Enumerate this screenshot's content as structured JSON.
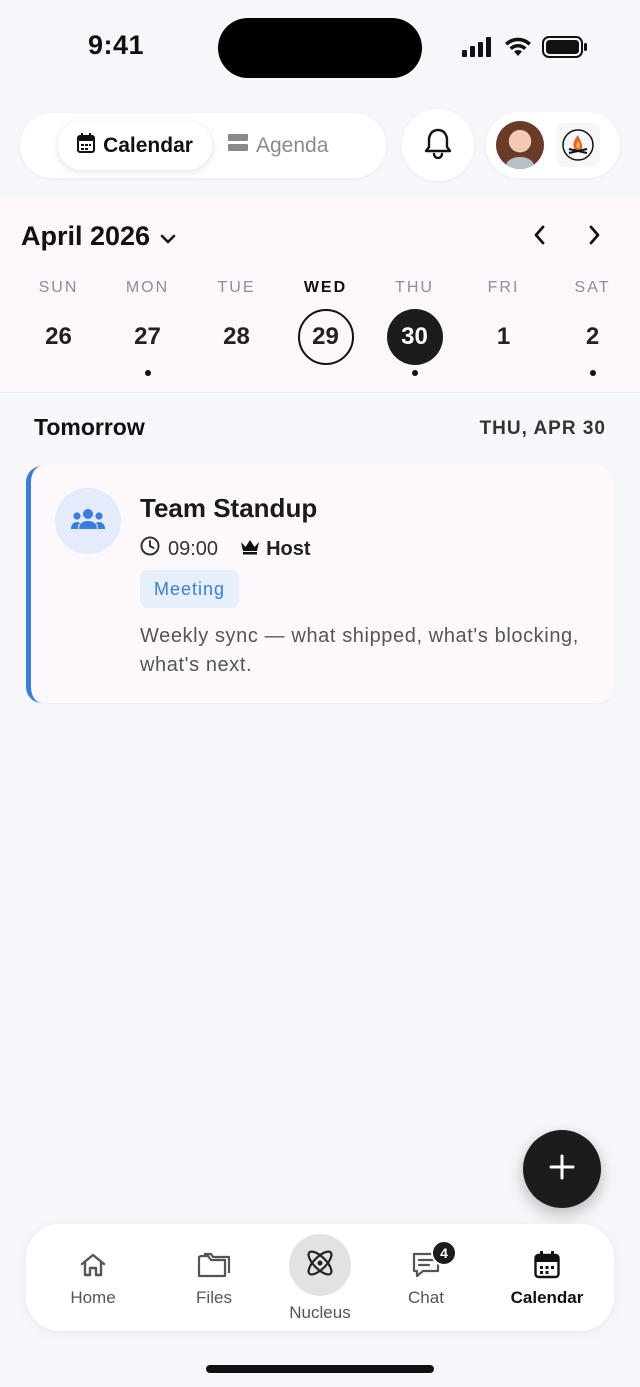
{
  "status_bar": {
    "time": "9:41"
  },
  "view_toggle": {
    "calendar_label": "Calendar",
    "agenda_label": "Agenda"
  },
  "calendar": {
    "month_label": "April 2026",
    "days": [
      {
        "name": "SUN",
        "num": "26",
        "dot": false,
        "state": "normal"
      },
      {
        "name": "MON",
        "num": "27",
        "dot": true,
        "state": "normal"
      },
      {
        "name": "TUE",
        "num": "28",
        "dot": false,
        "state": "normal"
      },
      {
        "name": "WED",
        "num": "29",
        "dot": false,
        "state": "today"
      },
      {
        "name": "THU",
        "num": "30",
        "dot": true,
        "state": "selected"
      },
      {
        "name": "FRI",
        "num": "1",
        "dot": false,
        "state": "normal"
      },
      {
        "name": "SAT",
        "num": "2",
        "dot": true,
        "state": "normal"
      }
    ]
  },
  "section": {
    "title": "Tomorrow",
    "date": "THU, APR 30"
  },
  "event": {
    "icon": "group-icon",
    "title": "Team Standup",
    "time": "09:00",
    "role": "Host",
    "tag": "Meeting",
    "description": "Weekly sync — what shipped, what's blocking, what's next.",
    "accent_color": "#3b7ddd"
  },
  "bottom_nav": {
    "home": "Home",
    "files": "Files",
    "nucleus": "Nucleus",
    "chat": "Chat",
    "chat_badge": "4",
    "calendar": "Calendar",
    "active": "Calendar"
  }
}
